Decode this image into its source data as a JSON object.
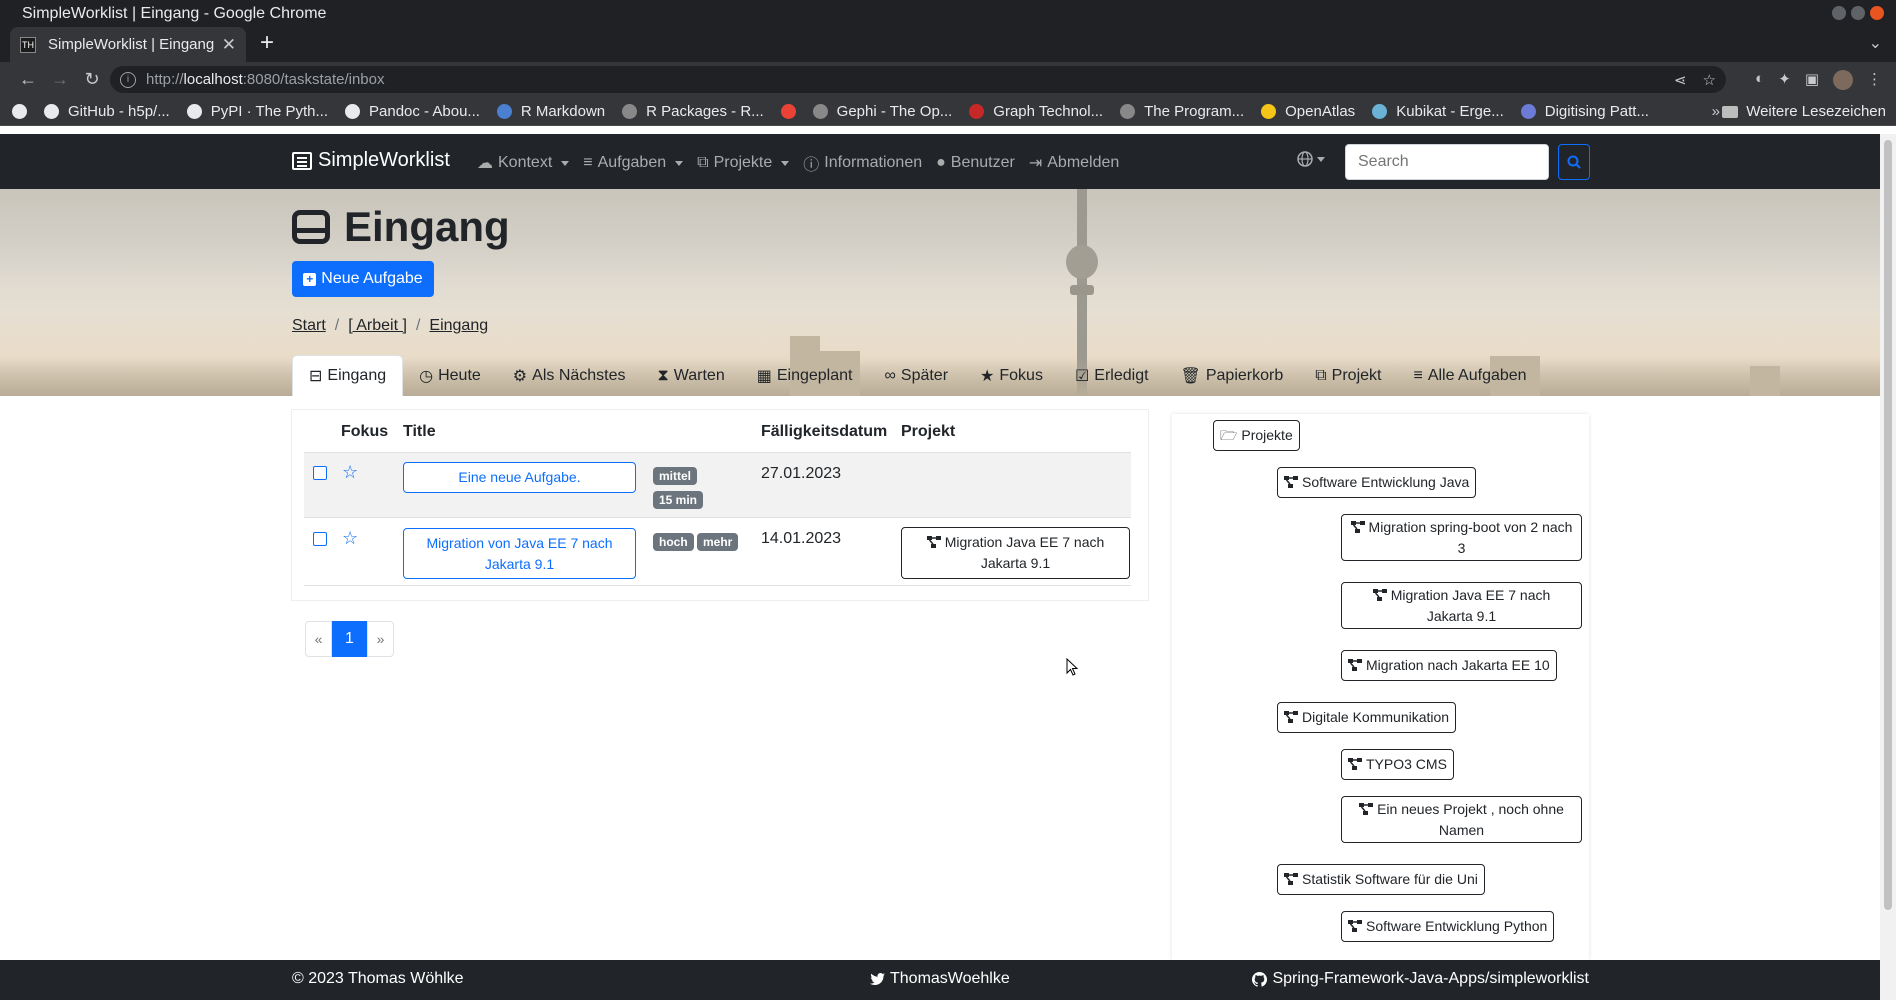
{
  "window": {
    "title": "SimpleWorklist | Eingang - Google Chrome"
  },
  "browser": {
    "tab_title": "SimpleWorklist | Eingang",
    "tab_favicon": "TH",
    "url_prefix": "http://",
    "url_host": "localhost",
    "url_path": ":8080/taskstate/inbox",
    "bookmarks": [
      {
        "label": "",
        "color": "#e8eaed"
      },
      {
        "label": "GitHub - h5p/...",
        "color": "#e8eaed"
      },
      {
        "label": "PyPI · The Pyth...",
        "color": "#e8eaed"
      },
      {
        "label": "Pandoc - Abou...",
        "color": "#e8eaed"
      },
      {
        "label": "R Markdown",
        "color": "#4a7fd1"
      },
      {
        "label": "R Packages - R...",
        "color": "#888"
      },
      {
        "label": "",
        "color": "#ea4335"
      },
      {
        "label": "Gephi - The Op...",
        "color": "#888"
      },
      {
        "label": "Graph Technol...",
        "color": "#c62828"
      },
      {
        "label": "The Program...",
        "color": "#888"
      },
      {
        "label": "OpenAtlas",
        "color": "#f5c518"
      },
      {
        "label": "Kubikat - Erge...",
        "color": "#6bb3d6"
      },
      {
        "label": "Digitising Patt...",
        "color": "#6b7bd6"
      }
    ],
    "bookmarks_more": "»",
    "other_bookmarks": "Weitere Lesezeichen"
  },
  "nav": {
    "brand": "SimpleWorklist",
    "links": [
      {
        "label": "Kontext",
        "dropdown": true,
        "icon": "cloud-icon"
      },
      {
        "label": "Aufgaben",
        "dropdown": true,
        "icon": "database-icon"
      },
      {
        "label": "Projekte",
        "dropdown": true,
        "icon": "project-diagram-icon"
      },
      {
        "label": "Informationen",
        "dropdown": false,
        "icon": "info-circle-icon"
      },
      {
        "label": "Benutzer",
        "dropdown": false,
        "icon": "user-icon"
      },
      {
        "label": "Abmelden",
        "dropdown": false,
        "icon": "sign-out-icon"
      }
    ],
    "search_placeholder": "Search"
  },
  "page": {
    "title": "Eingang",
    "new_task": "Neue Aufgabe",
    "breadcrumb": [
      "Start",
      "[ Arbeit ]",
      "Eingang"
    ]
  },
  "tabs": [
    {
      "label": "Eingang",
      "icon": "inbox-icon",
      "active": true
    },
    {
      "label": "Heute",
      "icon": "clock-icon"
    },
    {
      "label": "Als Nächstes",
      "icon": "cogs-icon"
    },
    {
      "label": "Warten",
      "icon": "hourglass-icon"
    },
    {
      "label": "Eingeplant",
      "icon": "calendar-icon"
    },
    {
      "label": "Später",
      "icon": "binoculars-icon"
    },
    {
      "label": "Fokus",
      "icon": "star-icon"
    },
    {
      "label": "Erledigt",
      "icon": "check-square-icon"
    },
    {
      "label": "Papierkorb",
      "icon": "trash-icon"
    },
    {
      "label": "Projekt",
      "icon": "project-diagram-icon"
    },
    {
      "label": "Alle Aufgaben",
      "icon": "database-icon"
    }
  ],
  "table": {
    "headers": {
      "focus": "Fokus",
      "title": "Title",
      "due": "Fälligkeitsdatum",
      "project": "Projekt"
    },
    "rows": [
      {
        "title": "Eine neue Aufgabe.",
        "badges": [
          "mittel",
          "15 min"
        ],
        "due": "27.01.2023",
        "project": ""
      },
      {
        "title": "Migration von Java EE 7 nach Jakarta 9.1",
        "badges": [
          "hoch",
          "mehr"
        ],
        "due": "14.01.2023",
        "project": "Migration Java EE 7 nach Jakarta 9.1"
      }
    ]
  },
  "pagination": {
    "prev": "«",
    "current": "1",
    "next": "»"
  },
  "project_tree": {
    "root": "Projekte",
    "nodes": [
      {
        "label": "Software Entwicklung Java",
        "level": 1
      },
      {
        "label": "Migration spring-boot von 2 nach 3",
        "level": 2
      },
      {
        "label": "Migration Java EE 7 nach Jakarta 9.1",
        "level": 2
      },
      {
        "label": "Migration nach Jakarta EE 10",
        "level": 2
      },
      {
        "label": "Digitale Kommunikation",
        "level": 1
      },
      {
        "label": "TYPO3 CMS",
        "level": 2
      },
      {
        "label": "Ein neues Projekt , noch ohne Namen",
        "level": 2
      },
      {
        "label": "Statistik Software für die Uni",
        "level": 1
      },
      {
        "label": "Software Entwicklung Python",
        "level": 2
      }
    ]
  },
  "footer": {
    "copyright": "© 2023 Thomas Wöhlke",
    "twitter": "ThomasWoehlke",
    "github": "Spring-Framework-Java-Apps/simpleworklist"
  },
  "colors": {
    "primary": "#0d6efd",
    "navbar": "#212529",
    "badge": "#6c757d"
  }
}
